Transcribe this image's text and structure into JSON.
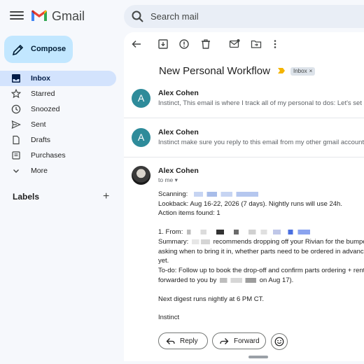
{
  "app": {
    "name": "Gmail"
  },
  "search": {
    "placeholder": "Search mail"
  },
  "compose": {
    "label": "Compose"
  },
  "nav": [
    {
      "label": "Inbox",
      "icon": "inbox-icon",
      "active": true
    },
    {
      "label": "Starred",
      "icon": "star-icon"
    },
    {
      "label": "Snoozed",
      "icon": "clock-icon"
    },
    {
      "label": "Sent",
      "icon": "send-icon"
    },
    {
      "label": "Drafts",
      "icon": "draft-icon"
    },
    {
      "label": "Purchases",
      "icon": "purchases-icon"
    },
    {
      "label": "More",
      "icon": "chevron-down-icon"
    }
  ],
  "labels": {
    "heading": "Labels",
    "add": "+"
  },
  "thread": {
    "subject": "New Personal Workflow",
    "chip": "Inbox",
    "chip_close": "×",
    "messages": [
      {
        "initial": "A",
        "from": "Alex Cohen",
        "snippet": "Instinct, This email is where I track all of my personal to dos: Let's set up a"
      },
      {
        "initial": "A",
        "from": "Alex Cohen",
        "snippet": "Instinct make sure you reply to this email from my other gmail account with"
      }
    ],
    "expanded": {
      "from": "Alex Cohen",
      "to": "to me ▾",
      "lines": {
        "scanning": "Scanning:",
        "lookback": "Lookback: Aug 16-22, 2026 (7 days). Nightly runs will use 24h.",
        "action_items": "Action items found: 1",
        "from_item": "1. From:",
        "summary_a": "Summary:",
        "summary_b": "recommends dropping off your Rivian for the bumper rep",
        "asking": "asking when to bring it in, whether parts need to be ordered in advance, an",
        "yet": "yet.",
        "todo": "To-do: Follow up to book the drop-off and confirm parts ordering + rental ca",
        "forwarded_a": "forwarded to you by",
        "forwarded_b": "on Aug 17).",
        "next": "Next digest runs nightly at 6 PM CT.",
        "sign": "Instinct"
      }
    },
    "actions": {
      "reply": "Reply",
      "forward": "Forward"
    }
  },
  "colors": {
    "accent": "#c2e7ff",
    "active_nav": "#d3e3fd",
    "avatar": "#2e8b9a",
    "chip_arrow": "#f4b400"
  }
}
